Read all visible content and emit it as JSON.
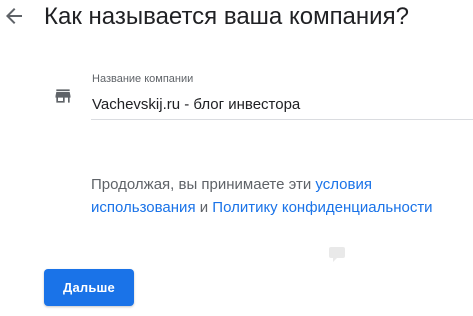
{
  "header": {
    "back_icon": "arrow-left-icon",
    "title": "Как называется ваша компания?"
  },
  "form": {
    "field_icon": "storefront-icon",
    "label": "Название компании",
    "value": "Vachevskij.ru - блог инвестора"
  },
  "terms": {
    "prefix": "Продолжая, вы принимаете эти ",
    "link_terms": "условия использования",
    "conjunction": " и ",
    "link_privacy": "Политику конфиденциальности"
  },
  "watermark": {
    "icon": "logo-watermark-icon"
  },
  "actions": {
    "next_label": "Дальше"
  },
  "colors": {
    "accent": "#1a73e8",
    "text_primary": "#202124",
    "text_secondary": "#5f6368",
    "divider": "#dadce0"
  }
}
